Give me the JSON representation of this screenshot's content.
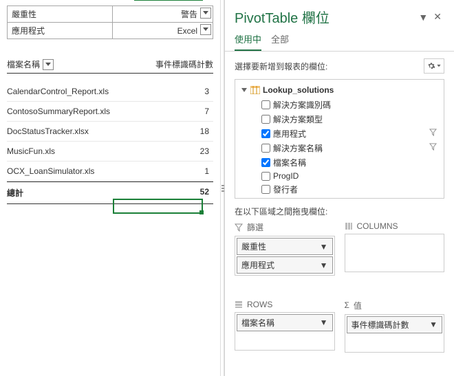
{
  "filters": [
    {
      "label": "嚴重性",
      "value": "警告"
    },
    {
      "label": "應用程式",
      "value": "Excel"
    }
  ],
  "pivot": {
    "row_header": "檔案名稱",
    "val_header": "事件標識碼計數",
    "rows": [
      {
        "name": "CalendarControl_Report.xls",
        "count": 3
      },
      {
        "name": "ContosoSummaryReport.xls",
        "count": 7
      },
      {
        "name": "DocStatusTracker.xlsx",
        "count": 18
      },
      {
        "name": "MusicFun.xls",
        "count": 23
      },
      {
        "name": "OCX_LoanSimulator.xls",
        "count": 1
      }
    ],
    "total_label": "總計",
    "total_value": 52
  },
  "panel": {
    "title": "PivotTable 欄位",
    "tabs": {
      "active": "使用中",
      "all": "全部"
    },
    "choose_text": "選擇要新增到報表的欄位:",
    "table_name": "Lookup_solutions",
    "fields": [
      {
        "label": "解決方案識別碼",
        "checked": false,
        "filter": false
      },
      {
        "label": "解決方案類型",
        "checked": false,
        "filter": false
      },
      {
        "label": "應用程式",
        "checked": true,
        "filter": true
      },
      {
        "label": "解決方案名稱",
        "checked": false,
        "filter": true
      },
      {
        "label": "檔案名稱",
        "checked": true,
        "filter": false
      },
      {
        "label": "ProgID",
        "checked": false,
        "filter": false
      },
      {
        "label": "發行者",
        "checked": false,
        "filter": false
      }
    ],
    "areas_label": "在以下區域之間拖曳欄位:",
    "area_filter": "篩選",
    "area_columns": "COLUMNS",
    "area_rows": "ROWS",
    "area_values": "值",
    "filter_fields": [
      "嚴重性",
      "應用程式"
    ],
    "row_fields": [
      "檔案名稱"
    ],
    "value_fields": [
      "事件標識碼計數"
    ]
  }
}
